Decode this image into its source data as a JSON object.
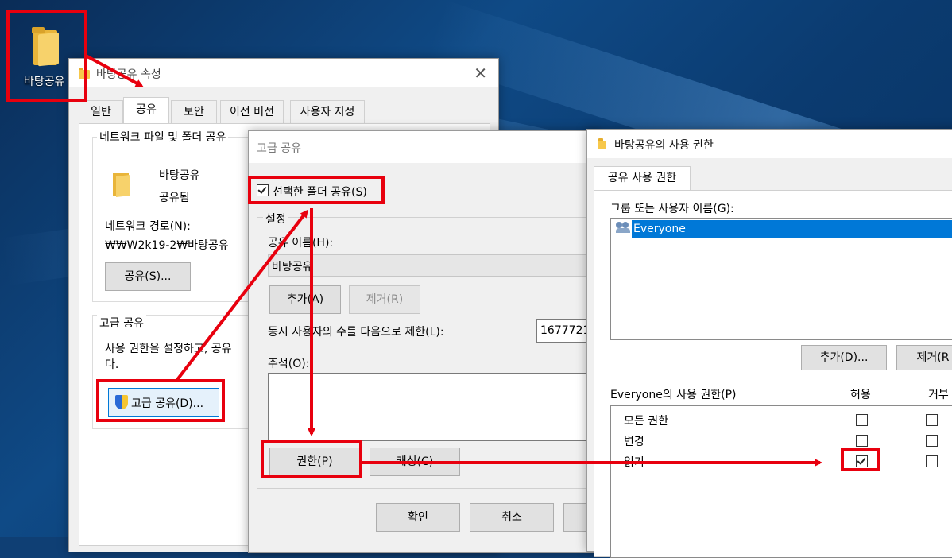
{
  "desktop": {
    "folder_label": "바탕공유"
  },
  "props": {
    "title": "바탕공유 속성",
    "tabs": [
      "일반",
      "공유",
      "보안",
      "이전 버전",
      "사용자 지정"
    ],
    "net_group_title": "네트워크 파일 및 폴더 공유",
    "folder_name": "바탕공유",
    "share_state": "공유됨",
    "net_path_label": "네트워크 경로(N):",
    "net_path": "₩₩W2k19-2₩바탕공유",
    "share_button": "공유(S)...",
    "adv_group_title": "고급 공유",
    "adv_desc_1": "사용 권한을 설정하고, 공유",
    "adv_desc_2": "다.",
    "adv_button": "고급 공유(D)..."
  },
  "adv": {
    "title": "고급 공유",
    "share_checkbox": "선택한 폴더 공유(S)",
    "settings_title": "설정",
    "share_name_label": "공유 이름(H):",
    "share_name_value": "바탕공유",
    "add_button": "추가(A)",
    "remove_button": "제거(R)",
    "limit_label": "동시 사용자의 수를 다음으로 제한(L):",
    "limit_value": "1677721",
    "comment_label": "주석(O):",
    "perm_button": "권한(P)",
    "cache_button": "캐싱(C)",
    "ok_button": "확인",
    "cancel_button": "취소"
  },
  "perm": {
    "title": "바탕공유의 사용 권한",
    "tab": "공유 사용 권한",
    "users_label": "그룹 또는 사용자 이름(G):",
    "user": "Everyone",
    "add_button": "추가(D)...",
    "remove_button": "제거(R",
    "perm_label": "Everyone의 사용 권한(P)",
    "allow_header": "허용",
    "deny_header": "거부",
    "rows": [
      {
        "name": "모든 권한",
        "allow": false,
        "deny": false
      },
      {
        "name": "변경",
        "allow": false,
        "deny": false
      },
      {
        "name": "읽기",
        "allow": true,
        "deny": false
      }
    ]
  },
  "colors": {
    "highlight": "#e8000e",
    "selection": "#0078d7"
  }
}
